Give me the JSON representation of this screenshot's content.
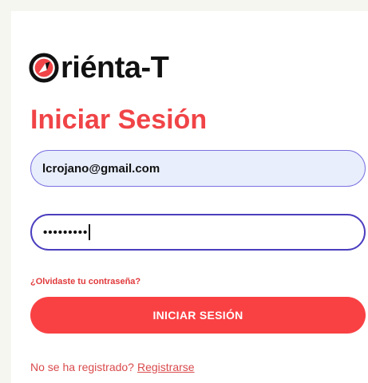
{
  "brand": {
    "name": "riénta-T",
    "icon": "compass-o-icon",
    "accent": "#f04447"
  },
  "login": {
    "title": "Iniciar Sesión",
    "email_value": "lcrojano@gmail.com",
    "password_masked": "•••••••••",
    "forgot_label": "¿Olvidaste tu contraseña?",
    "submit_label": "INICIAR SESIÓN",
    "register_prompt": "No se ha registrado?",
    "register_link": "Registrarse"
  }
}
